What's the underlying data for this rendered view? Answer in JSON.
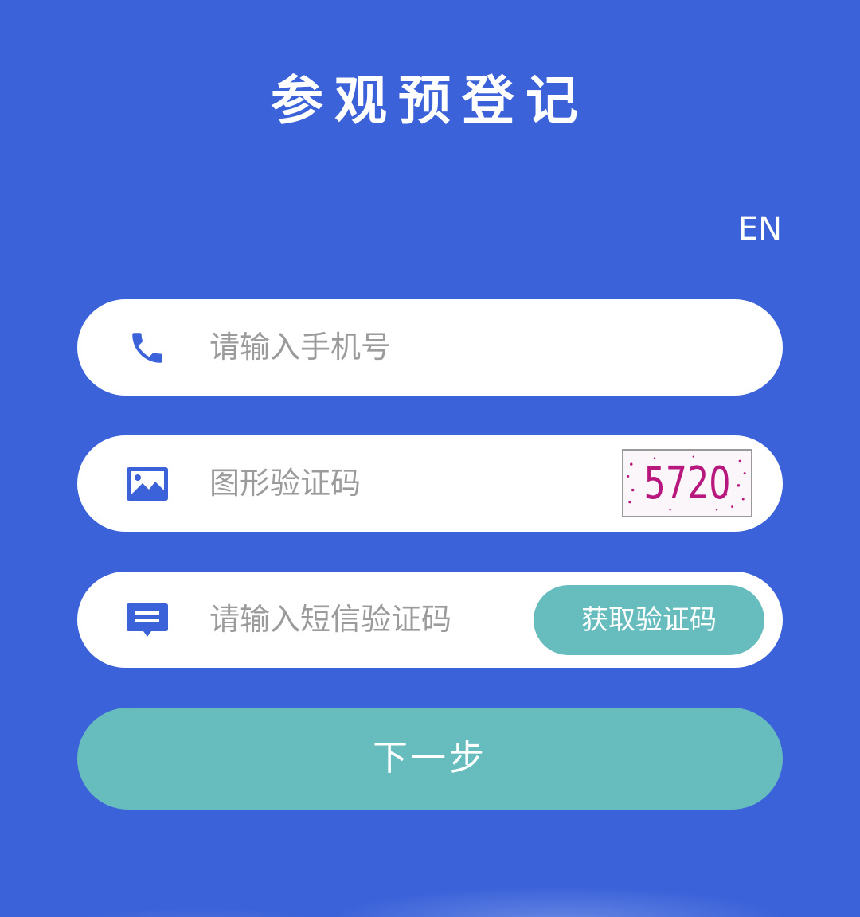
{
  "header": {
    "title": "参观预登记",
    "lang_toggle": "EN"
  },
  "form": {
    "phone": {
      "icon": "phone-icon",
      "placeholder": "请输入手机号",
      "value": ""
    },
    "captcha": {
      "icon": "image-icon",
      "placeholder": "图形验证码",
      "value": "",
      "captcha_text": "5720"
    },
    "sms": {
      "icon": "message-icon",
      "placeholder": "请输入短信验证码",
      "value": "",
      "get_code_label": "获取验证码"
    },
    "next_label": "下一步"
  },
  "colors": {
    "background": "#3b62d9",
    "icon": "#3b62d9",
    "accent": "#67bcbe",
    "captcha_text": "#b8177d"
  }
}
